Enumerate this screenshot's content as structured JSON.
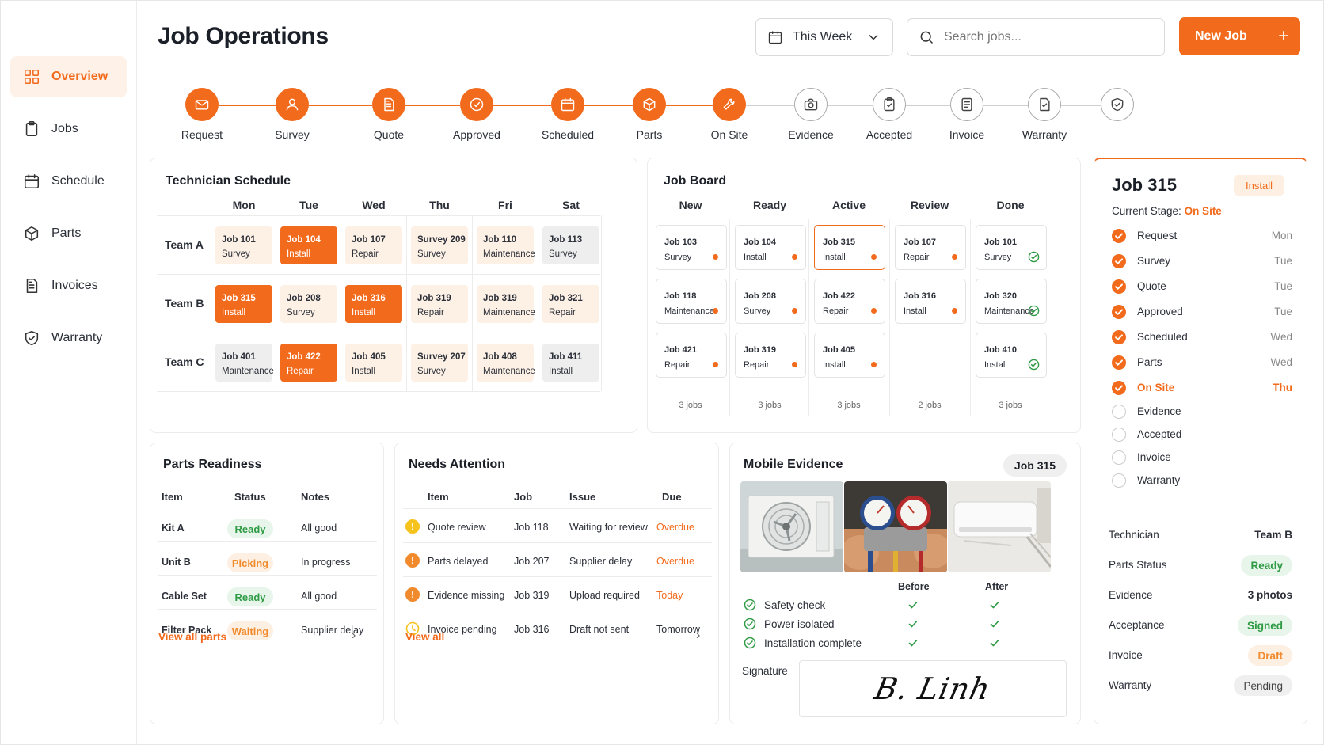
{
  "app": {
    "title": "Job Operations"
  },
  "sidebar": {
    "items": [
      {
        "label": "Overview",
        "icon": "grid-icon",
        "active": true
      },
      {
        "label": "Jobs",
        "icon": "clipboard-icon"
      },
      {
        "label": "Schedule",
        "icon": "calendar-icon"
      },
      {
        "label": "Parts",
        "icon": "box-icon"
      },
      {
        "label": "Invoices",
        "icon": "document-icon"
      },
      {
        "label": "Warranty",
        "icon": "shield-icon"
      }
    ]
  },
  "header": {
    "week_filter": "This Week",
    "search_placeholder": "Search jobs...",
    "new_job_label": "New Job"
  },
  "pipeline": {
    "steps": [
      {
        "label": "Request",
        "icon": "mail-icon",
        "done": true
      },
      {
        "label": "Survey",
        "icon": "user-icon",
        "done": true
      },
      {
        "label": "Quote",
        "icon": "document-icon",
        "done": true
      },
      {
        "label": "Approved",
        "icon": "check-circle-icon",
        "done": true
      },
      {
        "label": "Scheduled",
        "icon": "calendar-icon",
        "done": true
      },
      {
        "label": "Parts",
        "icon": "box-icon",
        "done": true
      },
      {
        "label": "On Site",
        "icon": "wrench-icon",
        "done": true
      },
      {
        "label": "Evidence",
        "icon": "camera-icon",
        "done": false
      },
      {
        "label": "Accepted",
        "icon": "clipboard-check-icon",
        "done": false
      },
      {
        "label": "Invoice",
        "icon": "invoice-icon",
        "done": false
      },
      {
        "label": "Warranty",
        "icon": "warranty-doc-icon",
        "done": false
      },
      {
        "label": "",
        "icon": "shield-check-icon",
        "done": false
      }
    ]
  },
  "schedule": {
    "title": "Technician Schedule",
    "days": [
      "Mon",
      "Tue",
      "Wed",
      "Thu",
      "Fri",
      "Sat"
    ],
    "teams": [
      {
        "name": "Team A",
        "jobs": [
          {
            "job": "Job 101",
            "type": "Survey",
            "style": "ivory"
          },
          {
            "job": "Job 104",
            "type": "Install",
            "style": "orange"
          },
          {
            "job": "Job 107",
            "type": "Repair",
            "style": "ivory"
          },
          {
            "job": "Survey 209",
            "type": "Survey",
            "style": "ivory"
          },
          {
            "job": "Job 110",
            "type": "Maintenance",
            "style": "ivory"
          },
          {
            "job": "Job 113",
            "type": "Survey",
            "style": "grey"
          }
        ]
      },
      {
        "name": "Team B",
        "jobs": [
          {
            "job": "Job 315",
            "type": "Install",
            "style": "orange"
          },
          {
            "job": "Job 208",
            "type": "Survey",
            "style": "ivory"
          },
          {
            "job": "Job 316",
            "type": "Install",
            "style": "orange"
          },
          {
            "job": "Job 319",
            "type": "Repair",
            "style": "ivory"
          },
          {
            "job": "Job 319",
            "type": "Maintenance",
            "style": "ivory"
          },
          {
            "job": "Job 321",
            "type": "Repair",
            "style": "ivory"
          }
        ]
      },
      {
        "name": "Team C",
        "jobs": [
          {
            "job": "Job 401",
            "type": "Maintenance",
            "style": "grey"
          },
          {
            "job": "Job 422",
            "type": "Repair",
            "style": "orange"
          },
          {
            "job": "Job 405",
            "type": "Install",
            "style": "ivory"
          },
          {
            "job": "Survey 207",
            "type": "Survey",
            "style": "ivory"
          },
          {
            "job": "Job 408",
            "type": "Maintenance",
            "style": "ivory"
          },
          {
            "job": "Job 411",
            "type": "Install",
            "style": "grey"
          }
        ]
      }
    ]
  },
  "board": {
    "title": "Job Board",
    "columns": [
      {
        "name": "New",
        "count": "3 jobs",
        "cards": [
          {
            "job": "Job 103",
            "type": "Survey",
            "status": "dot"
          },
          {
            "job": "Job 118",
            "type": "Maintenance",
            "status": "dot"
          },
          {
            "job": "Job 421",
            "type": "Repair",
            "status": "dot"
          }
        ]
      },
      {
        "name": "Ready",
        "count": "3 jobs",
        "cards": [
          {
            "job": "Job 104",
            "type": "Install",
            "status": "dot"
          },
          {
            "job": "Job 208",
            "type": "Survey",
            "status": "dot"
          },
          {
            "job": "Job 319",
            "type": "Repair",
            "status": "dot"
          }
        ]
      },
      {
        "name": "Active",
        "count": "3 jobs",
        "cards": [
          {
            "job": "Job 315",
            "type": "Install",
            "status": "dot",
            "highlight": true
          },
          {
            "job": "Job 422",
            "type": "Repair",
            "status": "dot"
          },
          {
            "job": "Job 405",
            "type": "Install",
            "status": "dot"
          }
        ]
      },
      {
        "name": "Review",
        "count": "2 jobs",
        "cards": [
          {
            "job": "Job 107",
            "type": "Repair",
            "status": "dot"
          },
          {
            "job": "Job 316",
            "type": "Install",
            "status": "dot"
          }
        ]
      },
      {
        "name": "Done",
        "count": "3 jobs",
        "cards": [
          {
            "job": "Job 101",
            "type": "Survey",
            "status": "check"
          },
          {
            "job": "Job 320",
            "type": "Maintenance",
            "status": "check"
          },
          {
            "job": "Job 410",
            "type": "Install",
            "status": "check"
          }
        ]
      }
    ]
  },
  "parts": {
    "title": "Parts Readiness",
    "headers": [
      "Item",
      "Status",
      "Notes"
    ],
    "rows": [
      {
        "item": "Kit A",
        "status": "Ready",
        "tone": "green",
        "notes": "All good"
      },
      {
        "item": "Unit B",
        "status": "Picking",
        "tone": "amber",
        "notes": "In progress"
      },
      {
        "item": "Cable Set",
        "status": "Ready",
        "tone": "green",
        "notes": "All good"
      },
      {
        "item": "Filter Pack",
        "status": "Waiting",
        "tone": "amber",
        "notes": "Supplier delay"
      }
    ],
    "link": "View all parts"
  },
  "attention": {
    "title": "Needs Attention",
    "headers": [
      "Item",
      "Job",
      "Issue",
      "Due"
    ],
    "rows": [
      {
        "item": "Quote review",
        "job": "Job 118",
        "issue": "Waiting for review",
        "due": "Overdue",
        "icon": "warning-yellow-icon",
        "due_tone": "orange"
      },
      {
        "item": "Parts delayed",
        "job": "Job 207",
        "issue": "Supplier delay",
        "due": "Overdue",
        "icon": "warning-orange-icon",
        "due_tone": "orange"
      },
      {
        "item": "Evidence missing",
        "job": "Job 319",
        "issue": "Upload required",
        "due": "Today",
        "icon": "warning-orange-icon",
        "due_tone": "orange"
      },
      {
        "item": "Invoice pending",
        "job": "Job 316",
        "issue": "Draft not sent",
        "due": "Tomorrow",
        "icon": "clock-icon",
        "due_tone": "dark"
      }
    ],
    "link": "View all"
  },
  "evidence": {
    "title": "Mobile Evidence",
    "job": "Job 315",
    "photos": [
      "outdoor-unit-photo",
      "pressure-gauges-photo",
      "indoor-unit-photo"
    ],
    "before_label": "Before",
    "after_label": "After",
    "checks": [
      "Safety check",
      "Power isolated",
      "Installation complete"
    ],
    "signature_label": "Signature",
    "signature": "B. Linh"
  },
  "job_detail": {
    "title": "Job 315",
    "type_badge": "Install",
    "stage_label": "Current Stage:",
    "stage_value": "On Site",
    "stages": [
      {
        "name": "Request",
        "day": "Mon",
        "state": "done"
      },
      {
        "name": "Survey",
        "day": "Tue",
        "state": "done"
      },
      {
        "name": "Quote",
        "day": "Tue",
        "state": "done"
      },
      {
        "name": "Approved",
        "day": "Tue",
        "state": "done"
      },
      {
        "name": "Scheduled",
        "day": "Wed",
        "state": "done"
      },
      {
        "name": "Parts",
        "day": "Wed",
        "state": "done"
      },
      {
        "name": "On Site",
        "day": "Thu",
        "state": "current"
      },
      {
        "name": "Evidence",
        "day": "",
        "state": "todo"
      },
      {
        "name": "Accepted",
        "day": "",
        "state": "todo"
      },
      {
        "name": "Invoice",
        "day": "",
        "state": "todo"
      },
      {
        "name": "Warranty",
        "day": "",
        "state": "todo"
      }
    ],
    "details": [
      {
        "key": "Technician",
        "value": "Team B",
        "tone": "plain"
      },
      {
        "key": "Parts Status",
        "value": "Ready",
        "tone": "green"
      },
      {
        "key": "Evidence",
        "value": "3 photos",
        "tone": "plain"
      },
      {
        "key": "Acceptance",
        "value": "Signed",
        "tone": "green"
      },
      {
        "key": "Invoice",
        "value": "Draft",
        "tone": "amber"
      },
      {
        "key": "Warranty",
        "value": "Pending",
        "tone": "grey"
      }
    ]
  },
  "colors": {
    "accent": "#f26b1d",
    "green": "#2f9b45",
    "amber": "#f08a2c",
    "yellow": "#f6c21c"
  }
}
